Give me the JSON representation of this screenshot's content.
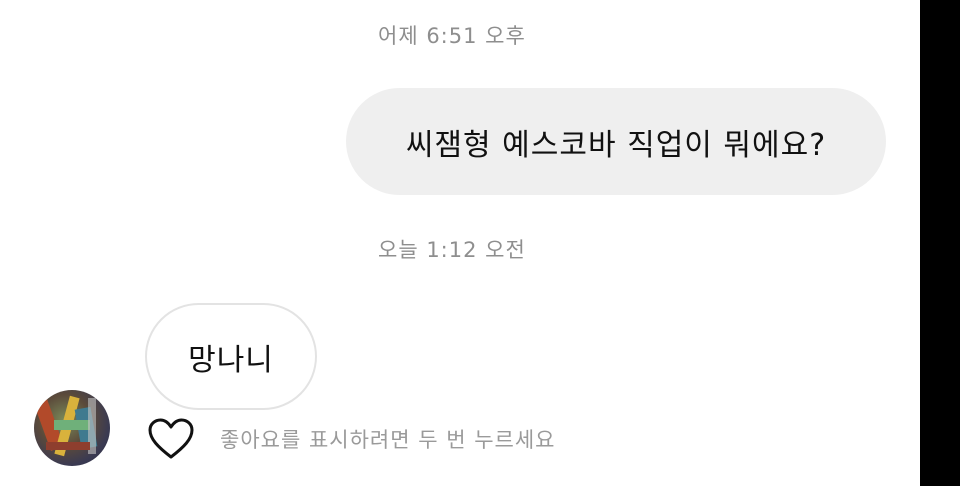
{
  "conversation": {
    "timestamp_1": "어제 6:51 오후",
    "sent_message": "씨잼형 예스코바 직업이 뭐에요?",
    "timestamp_2": "오늘 1:12 오전",
    "received_message": "망나니",
    "like_hint": "좋아요를 표시하려면 두 번 누르세요"
  },
  "icons": {
    "heart": "heart-icon",
    "avatar": "avatar"
  }
}
